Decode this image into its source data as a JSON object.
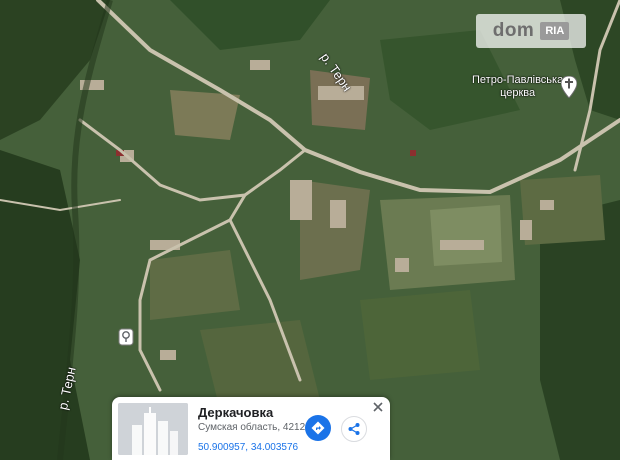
{
  "watermark": {
    "brand": "dom",
    "brand_sub": "RIA"
  },
  "labels": {
    "river_top": "р. Терн",
    "river_left": "р. Терн",
    "church": "Петро-Павлівська\nцерква"
  },
  "place_card": {
    "name": "Деркачовка",
    "address": "Сумская область, 42123",
    "coordinates": "50.900957, 34.003576"
  },
  "icons": {
    "church": "church-icon",
    "pin": "place-pin-icon",
    "directions": "directions-icon",
    "share": "share-icon",
    "close": "close-icon"
  },
  "colors": {
    "accent": "#1a73e8",
    "road": "#c9c2ad",
    "vegetation": "#2f4a26",
    "fields": "#6b7b52"
  }
}
